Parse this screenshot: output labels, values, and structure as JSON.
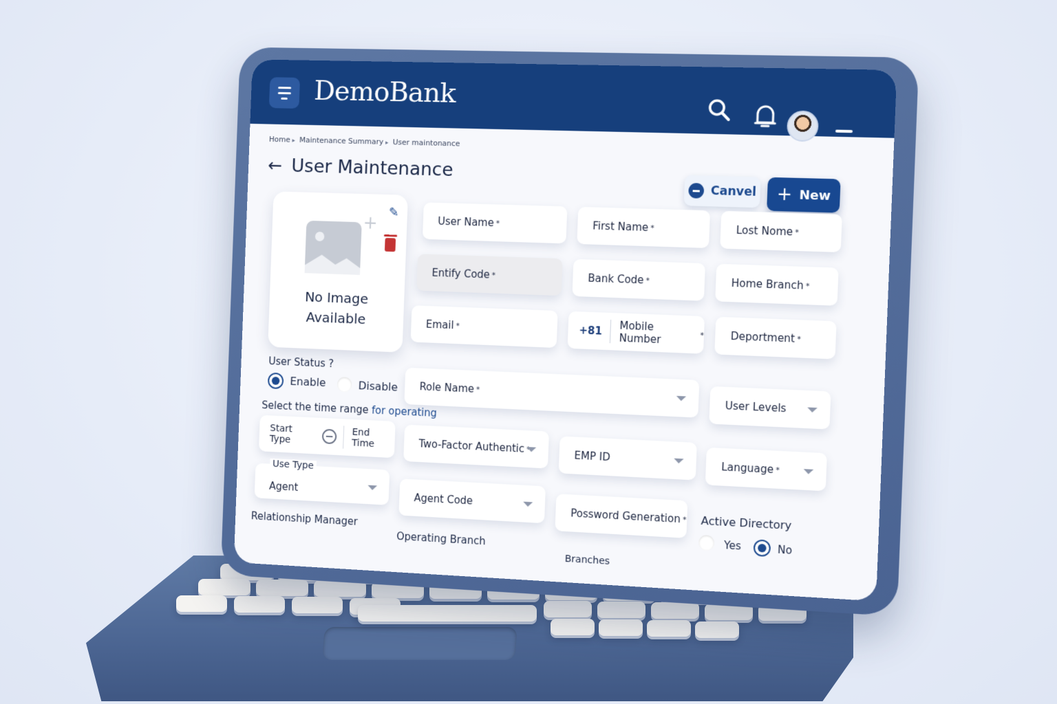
{
  "header": {
    "brand": "DemoBank"
  },
  "breadcrumb": {
    "items": [
      "Home",
      "Maintenance Summary",
      "User maintonance"
    ]
  },
  "page": {
    "title": "User Maintenance"
  },
  "actions": {
    "cancel_label": "Canvel",
    "new_label": "New"
  },
  "image_card": {
    "placeholder_text_line1": "No Image",
    "placeholder_text_line2": "Available"
  },
  "fields": {
    "user_name": "User Name",
    "first_name": "First Name",
    "last_name": "Lost Nome",
    "entity_code": "Entify Code",
    "bank_code": "Bank Code",
    "home_branch": "Home Branch",
    "email": "Email",
    "mobile_prefix": "+81",
    "mobile_number": "Mobile Number",
    "department": "Deportment",
    "role_name": "Role Name",
    "user_levels": "User Levels",
    "two_factor": "Two-Factor Authentic",
    "emp_id": "EMP ID",
    "language": "Language",
    "use_type_label": "Use Type",
    "use_type_value": "Agent",
    "agent_code": "Agent Code",
    "password_generation": "Possword Generation"
  },
  "required_marker": "*",
  "user_status": {
    "label": "User Status ?",
    "enable": "Enable",
    "disable": "Disable",
    "selected": "Enable"
  },
  "time_range": {
    "label_prefix": "Select the time range ",
    "label_highlight": "for operating",
    "start": "Start Type",
    "end": "End Time"
  },
  "active_directory": {
    "label": "Active Directory",
    "yes": "Yes",
    "no": "No",
    "selected": "No"
  },
  "section_labels": {
    "relationship_manager": "Relationship Manager",
    "operating_branch": "Operating Branch",
    "branches": "Branches"
  },
  "colors": {
    "brand": "#163f7c",
    "primary_button": "#184891",
    "danger": "#c43434"
  }
}
